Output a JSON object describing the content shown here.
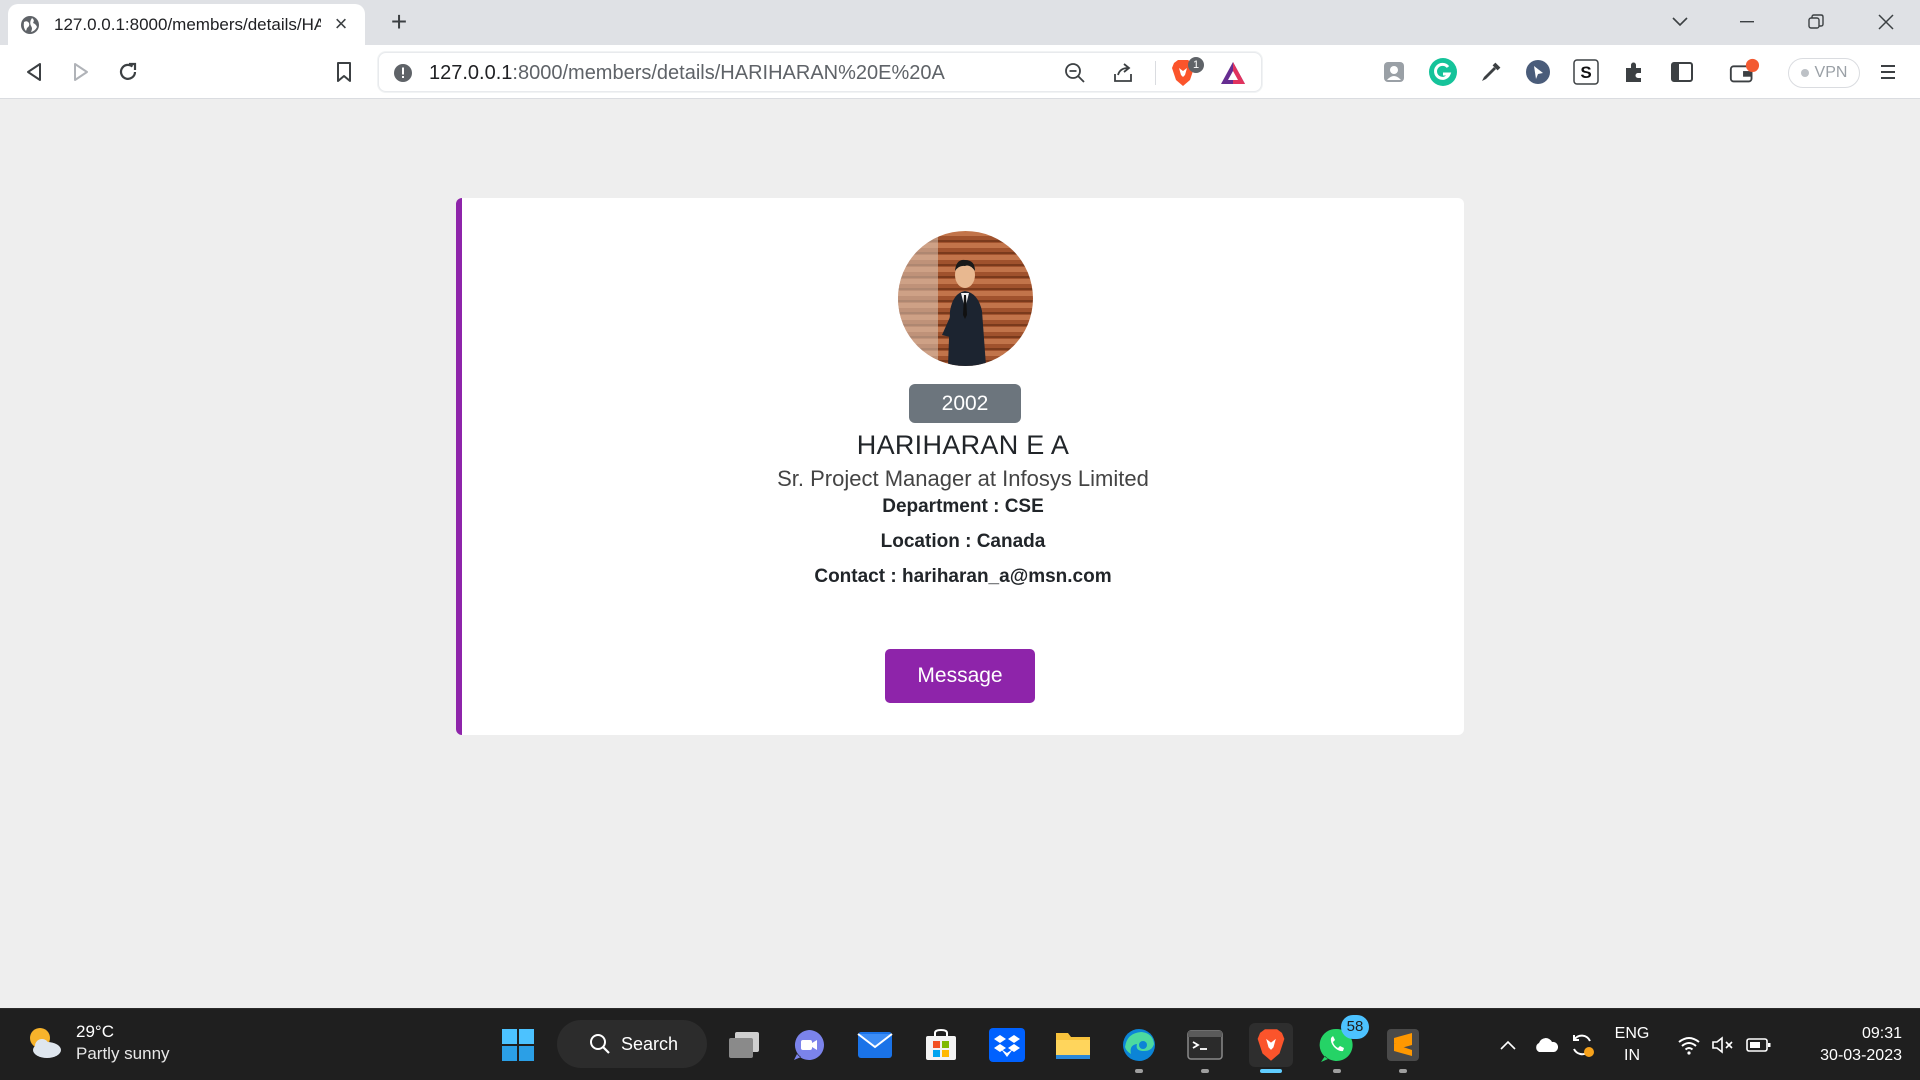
{
  "browser": {
    "tab_title": "127.0.0.1:8000/members/details/HARIHARAN%20E%20A",
    "url_host": "127.0.0.1",
    "url_path": ":8000/members/details/HARIHARAN%20E%20A",
    "brave_shield_count": "1",
    "vpn_label": "VPN"
  },
  "member": {
    "year": "2002",
    "name": "HARIHARAN E A",
    "title": "Sr. Project Manager at Infosys Limited",
    "department_label": "Department :",
    "department_value": "CSE",
    "location_label": "Location :",
    "location_value": "Canada",
    "contact_label": "Contact :",
    "contact_value": "hariharan_a@msn.com",
    "message_button": "Message"
  },
  "taskbar": {
    "weather_temp": "29°C",
    "weather_desc": "Partly sunny",
    "search_label": "Search",
    "whatsapp_badge": "58",
    "lang_top": "ENG",
    "lang_bottom": "IN",
    "time": "09:31",
    "date": "30-03-2023"
  },
  "colors": {
    "accent": "#8e24aa",
    "badge": "#6c757d",
    "page_bg": "#eeeeee",
    "taskbar_bg": "#1f1f1f"
  }
}
